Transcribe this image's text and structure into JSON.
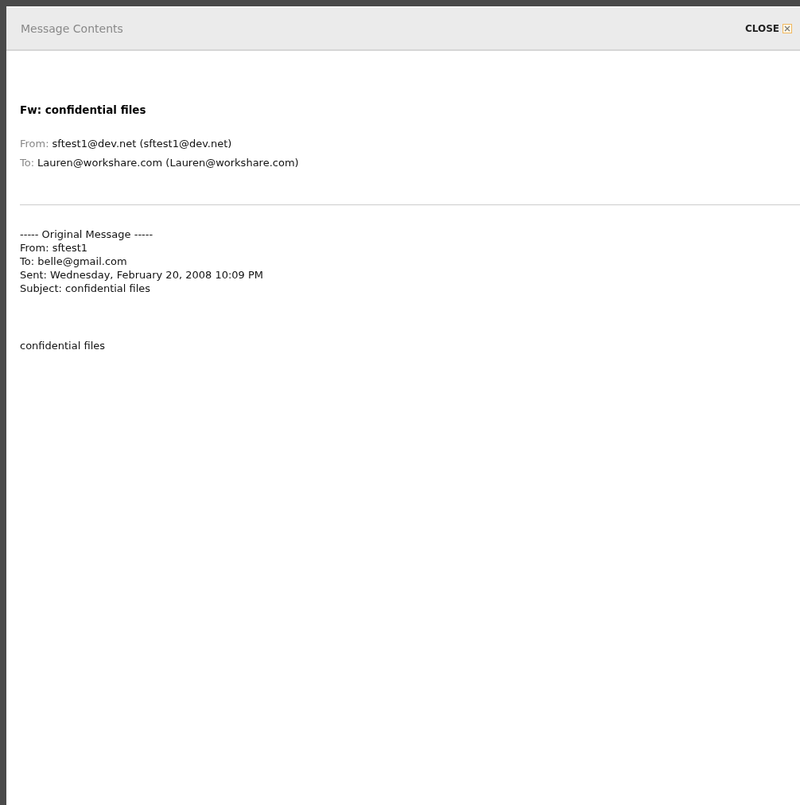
{
  "window": {
    "title": "Message Contents",
    "close": "CLOSE"
  },
  "message": {
    "subject": "Fw: confidential files",
    "fields": [
      {
        "label": "From:",
        "value": "sftest1@dev.net (sftest1@dev.net)"
      },
      {
        "label": "To:",
        "value": "Lauren@workshare.com (Lauren@workshare.com)"
      }
    ],
    "quoted_lines": [
      "----- Original Message -----",
      "From: sftest1",
      "To: belle@gmail.com",
      "Sent: Wednesday, February 20, 2008 10:09 PM",
      "Subject: confidential files"
    ],
    "body": "confidential files"
  }
}
